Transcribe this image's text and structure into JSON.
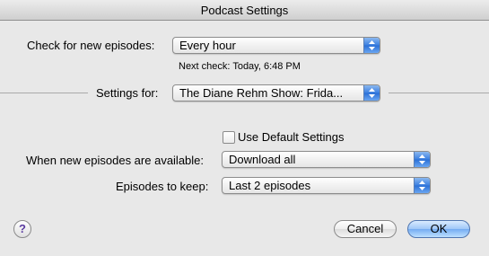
{
  "window": {
    "title": "Podcast Settings"
  },
  "check": {
    "label": "Check for new episodes:",
    "value": "Every hour",
    "next_check": "Next check: Today, 6:48 PM"
  },
  "settings_for": {
    "label": "Settings for:",
    "value": "The Diane Rehm Show: Frida..."
  },
  "default_settings": {
    "label": "Use Default Settings",
    "checked": false
  },
  "when_available": {
    "label": "When new episodes are available:",
    "value": "Download all"
  },
  "keep": {
    "label": "Episodes to keep:",
    "value": "Last 2 episodes"
  },
  "buttons": {
    "help": "?",
    "cancel": "Cancel",
    "ok": "OK"
  }
}
